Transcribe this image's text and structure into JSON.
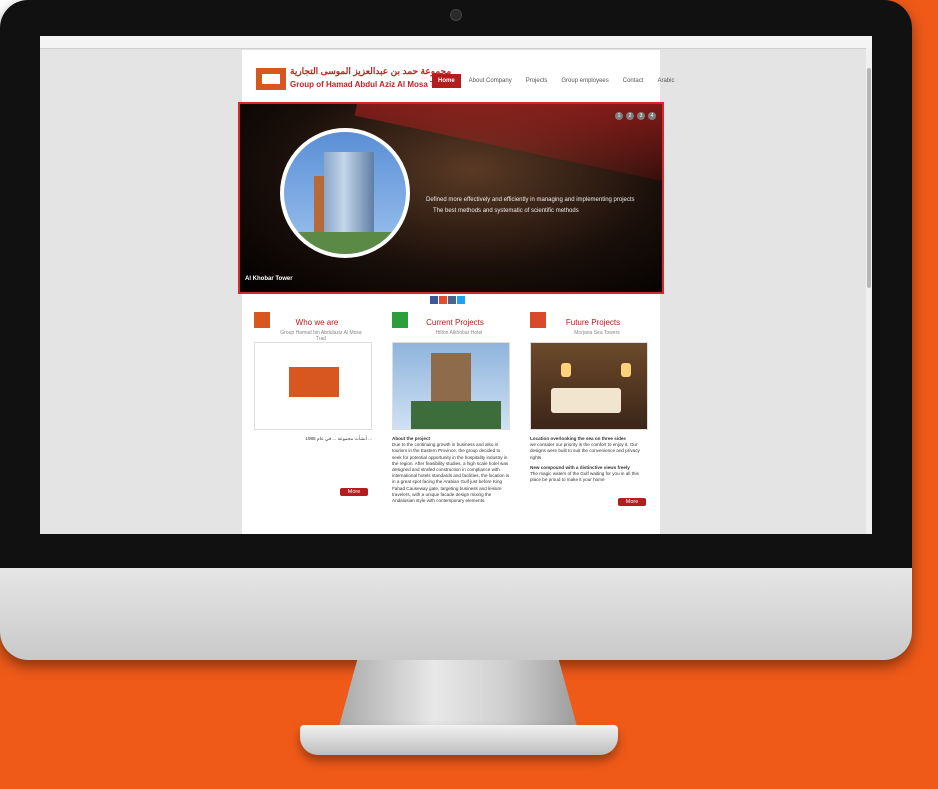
{
  "header": {
    "logo_arabic": "مجموعة حمد بن عبدالعزيز الموسى التجارية",
    "logo_english": "Group of Hamad Abdul Aziz Al Mosa Trad"
  },
  "nav": [
    {
      "label": "Home",
      "active": true
    },
    {
      "label": "About Company"
    },
    {
      "label": "Projects"
    },
    {
      "label": "Group employees"
    },
    {
      "label": "Contact"
    },
    {
      "label": "Arabic"
    }
  ],
  "hero": {
    "line1": "Defined more effectively and efficiently in managing and implementing projects",
    "line2": "The best methods and systematic of scientific methods",
    "caption": "Al Khobar Tower",
    "dots": [
      "1",
      "2",
      "3",
      "4"
    ]
  },
  "columns": [
    {
      "title": "Who we are",
      "subtitle": "Group Hamad bin Abdulaziz Al Mosa Trad",
      "body": "أنشأت مجموعة ... في عام 1985 ...",
      "more": "More"
    },
    {
      "title": "Current Projects",
      "subtitle": "Hilton Alkhobar Hotel",
      "body_title": "About the project",
      "body": "Due to the continuing growth in business and also in tourism in the Eastern Province, the group decided to seek for potential opportunity in the hospitality industry in the region. After feasibility studies, a high scale hotel was designed and strafed construction in compliance with international hotels standards and facilities, the location is in a great spot facing the Arabian Gulf just before King Fahad Causeway gate, targeting business and leisure travelers, with a unique facade design mixing the Andalusian style with contemporary elements."
    },
    {
      "title": "Future Projects",
      "subtitle": "Morjana Sea Towers",
      "body_title": "Location overlooking the sea on three sides",
      "body": "we consider our priority is the comfort to enjoy it. Our designs were built to suit the convenience and privacy rights",
      "body_title2": "New compound with a distinctive views freely",
      "body2": "The magic waters of the Gulf waiting for you in all this place be proud to make it your home",
      "more": "More"
    }
  ],
  "colors": {
    "accent": "#b41d1d",
    "background_orange": "#f05a19"
  }
}
